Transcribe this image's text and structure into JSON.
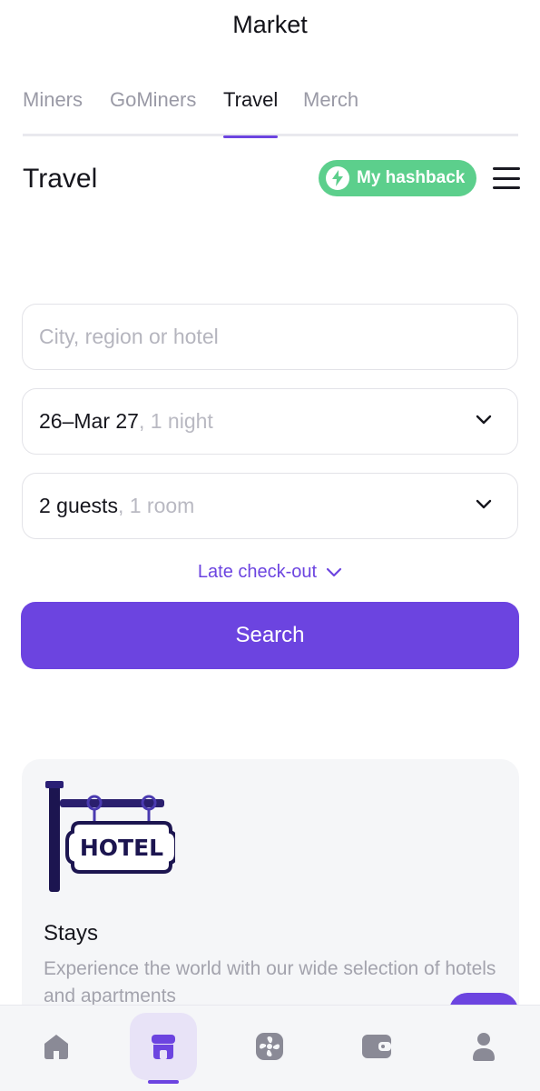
{
  "header": {
    "title": "Market"
  },
  "tabs": [
    {
      "label": "Miners"
    },
    {
      "label": "GoMiners"
    },
    {
      "label": "Travel"
    },
    {
      "label": "Merch"
    }
  ],
  "active_tab": "Travel",
  "section": {
    "title": "Travel",
    "hashback_label": "My hashback",
    "hashback_icon": "lightning-icon",
    "menu_icon": "hamburger-menu-icon"
  },
  "search_form": {
    "destination_placeholder": "City, region or hotel",
    "dates_value": "26–Mar 27",
    "dates_suffix": ", 1 night",
    "guests_value": "2 guests",
    "guests_suffix": ", 1 room",
    "late_checkout_label": "Late check-out",
    "search_label": "Search"
  },
  "card": {
    "image": "hotel-sign-illustration",
    "title": "Stays",
    "description": "Experience the world with our wide selection of hotels and apartments"
  },
  "bottom_nav": [
    {
      "icon": "home-icon"
    },
    {
      "icon": "market-icon"
    },
    {
      "icon": "fan-icon"
    },
    {
      "icon": "wallet-icon"
    },
    {
      "icon": "profile-icon"
    }
  ],
  "colors": {
    "accent": "#6c44e0",
    "hashback": "#5ccf8c",
    "text": "#16161d",
    "muted": "#9a9aa6"
  }
}
